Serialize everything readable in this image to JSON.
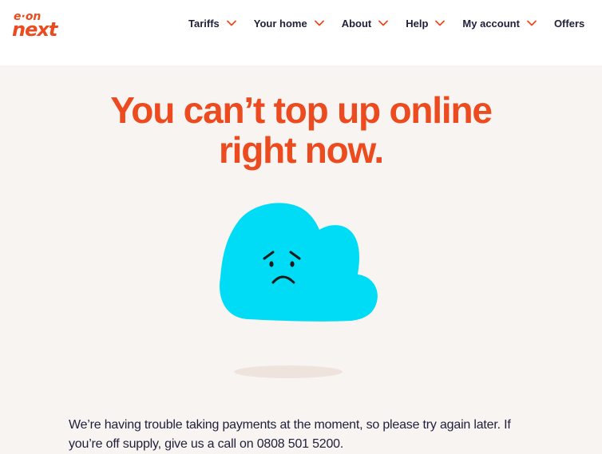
{
  "brand": {
    "logo_top": "e·on",
    "logo_bottom": "next",
    "color": "#ec4a1f"
  },
  "nav": {
    "items": [
      {
        "label": "Tariffs",
        "has_dropdown": true
      },
      {
        "label": "Your home",
        "has_dropdown": true
      },
      {
        "label": "About",
        "has_dropdown": true
      },
      {
        "label": "Help",
        "has_dropdown": true
      },
      {
        "label": "My account",
        "has_dropdown": true
      },
      {
        "label": "Offers",
        "has_dropdown": false
      }
    ]
  },
  "main": {
    "headline_line1": "You can’t top up online",
    "headline_line2": "right now.",
    "illustration": "sad-cloud-icon",
    "message": "We’re having trouble taking payments at the moment, so please try again later. If you’re off supply, give us a call on 0808 501 5200."
  },
  "colors": {
    "accent": "#ec4a1f",
    "cloud": "#00dcf5",
    "background": "#f8f4f1",
    "text": "#1f1f3a"
  }
}
